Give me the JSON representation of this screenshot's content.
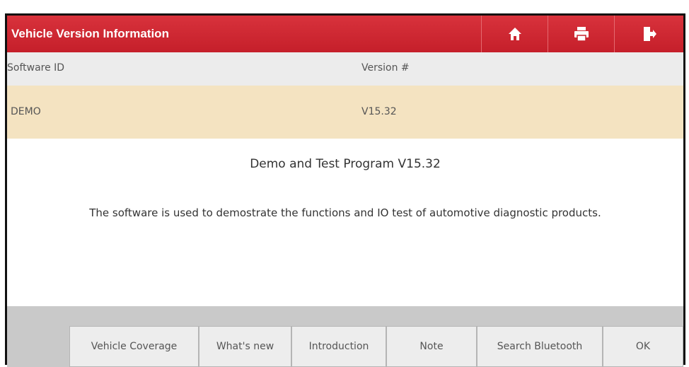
{
  "header": {
    "title": "Vehicle Version Information",
    "icons": [
      "home-icon",
      "print-icon",
      "exit-icon"
    ]
  },
  "table": {
    "columns": [
      "Software ID",
      "Version #"
    ],
    "rows": [
      [
        "DEMO",
        "V15.32"
      ]
    ],
    "selected_row_color": "#f4e3c1"
  },
  "description": {
    "title": "Demo and Test Program V15.32",
    "body": "The software is used to demostrate the functions and IO test of automotive diagnostic products."
  },
  "toolbar": {
    "buttons": [
      "Vehicle Coverage",
      "What's new",
      "Introduction",
      "Note",
      "Search Bluetooth",
      "OK"
    ]
  },
  "colors": {
    "header_red": "#c9222d",
    "toolbar_gray": "#c9c9c9"
  }
}
